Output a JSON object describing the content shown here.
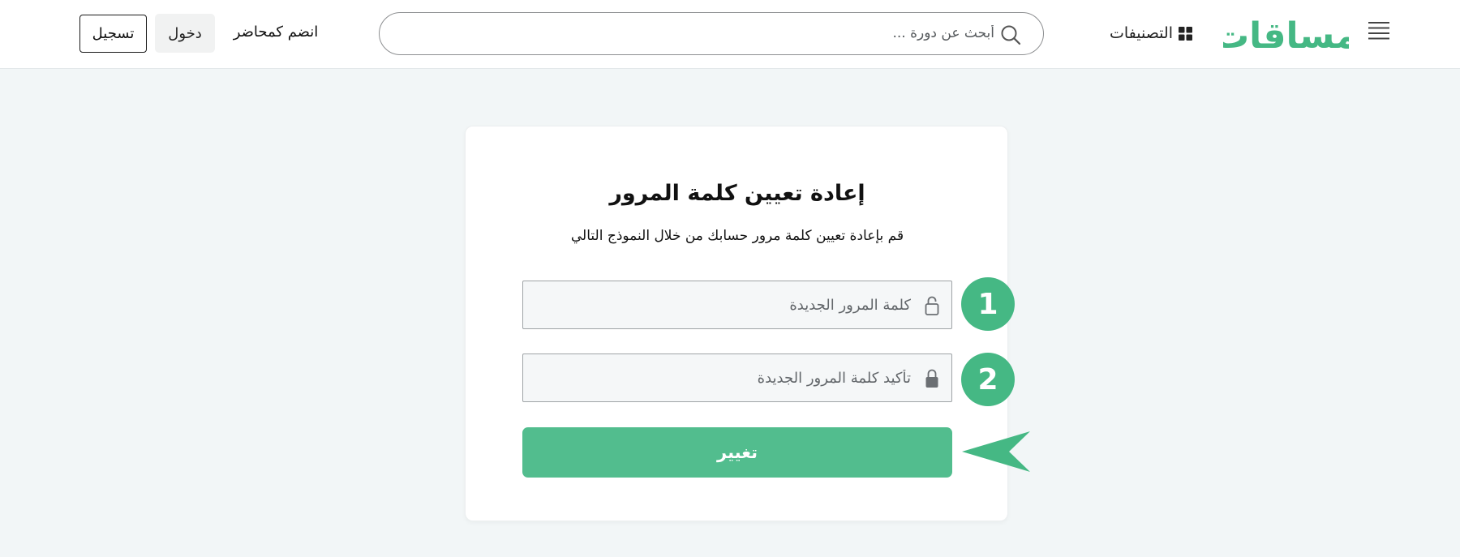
{
  "header": {
    "register_label": "تسجيل",
    "login_label": "دخول",
    "instructor_label": "انضم كمحاضر",
    "search_placeholder": "أبحث عن دورة ...",
    "categories_label": "التصنيفات",
    "logo_text": "مساقات",
    "icons": [
      "search-icon",
      "grid-icon",
      "menu-icon"
    ]
  },
  "card": {
    "title": "إعادة تعيين كلمة المرور",
    "subtitle": "قم بإعادة تعيين كلمة مرور حسابك من خلال النموذج التالي",
    "new_password_placeholder": "كلمة المرور الجديدة",
    "confirm_password_placeholder": "تأكيد كلمة المرور الجديدة",
    "submit_label": "تغيير",
    "icons": [
      "lock-open-icon",
      "lock-closed-icon"
    ]
  },
  "annotations": {
    "step_1": "1",
    "step_2": "2"
  },
  "colors": {
    "brand_green": "#45b884",
    "button_green": "#52bd8e",
    "page_bg": "#f2f6f7"
  }
}
